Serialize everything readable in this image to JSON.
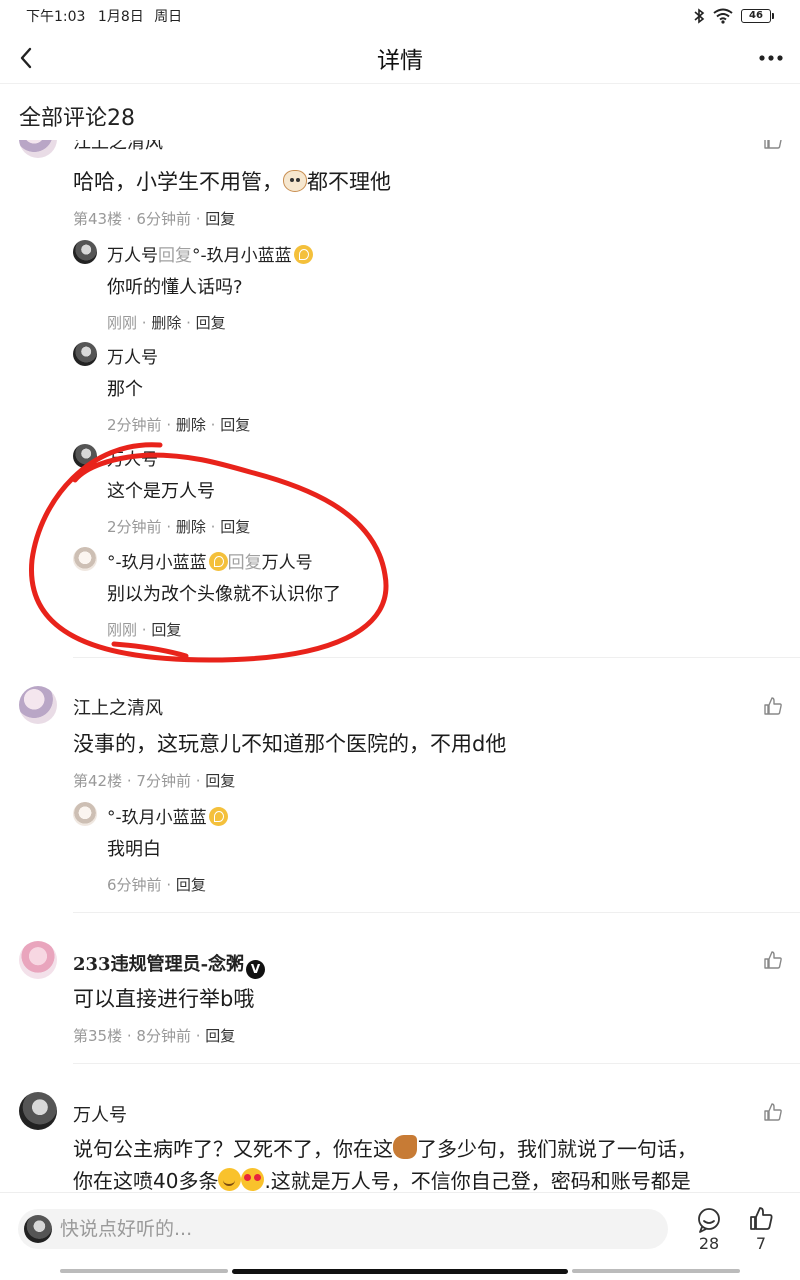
{
  "status": {
    "time": "下午1:03",
    "date": "1月8日",
    "weekday": "周日",
    "battery": "46"
  },
  "nav": {
    "title": "详情"
  },
  "section": {
    "title": "全部评论28"
  },
  "partial_top": {
    "name": "江上之清风"
  },
  "comment43": {
    "text": "哈哈，小学生不用管，",
    "text_after": "都不理他",
    "floor": "第43楼",
    "time": "6分钟前",
    "reply_action": "回复",
    "replies": [
      {
        "name": "万人号",
        "reply_word": "回复",
        "target": "°-玖月小蓝蓝",
        "text": "你听的懂人话吗?",
        "time": "刚刚",
        "delete": "删除",
        "reply": "回复"
      },
      {
        "name": "万人号",
        "text": "那个",
        "time": "2分钟前",
        "delete": "删除",
        "reply": "回复"
      },
      {
        "name": "万人号",
        "text": "这个是万人号",
        "time": "2分钟前",
        "delete": "删除",
        "reply": "回复"
      },
      {
        "name": "°-玖月小蓝蓝",
        "reply_word": "回复",
        "target": "万人号",
        "text": "别以为改个头像就不认识你了",
        "time": "刚刚",
        "reply": "回复"
      }
    ]
  },
  "comment42": {
    "name": "江上之清风",
    "text": "没事的，这玩意儿不知道那个医院的，不用d他",
    "floor": "第42楼",
    "time": "7分钟前",
    "reply_action": "回复",
    "reply": {
      "name": "°-玖月小蓝蓝",
      "text": "我明白",
      "time": "6分钟前",
      "reply": "回复"
    }
  },
  "comment35": {
    "name": "233违规管理员-念粥",
    "verified_badge": "V",
    "text": "可以直接进行举b哦",
    "floor": "第35楼",
    "time": "8分钟前",
    "reply_action": "回复"
  },
  "comment_last": {
    "name": "万人号",
    "line1_a": "说句公主病咋了？又死不了，你在这",
    "line1_b": "了多少句，我们就说了一句话，",
    "line2_a": "你在这喷40多条",
    "line2_b": ".这就是万人号，不信你自己登，密码和账号都是"
  },
  "bottom": {
    "placeholder": "快说点好听的...",
    "comment_count": "28",
    "like_count": "7"
  },
  "colors": {
    "annotation": "#e8231b",
    "secondary_text": "#999999",
    "reply_word": "#a0a0a0"
  }
}
